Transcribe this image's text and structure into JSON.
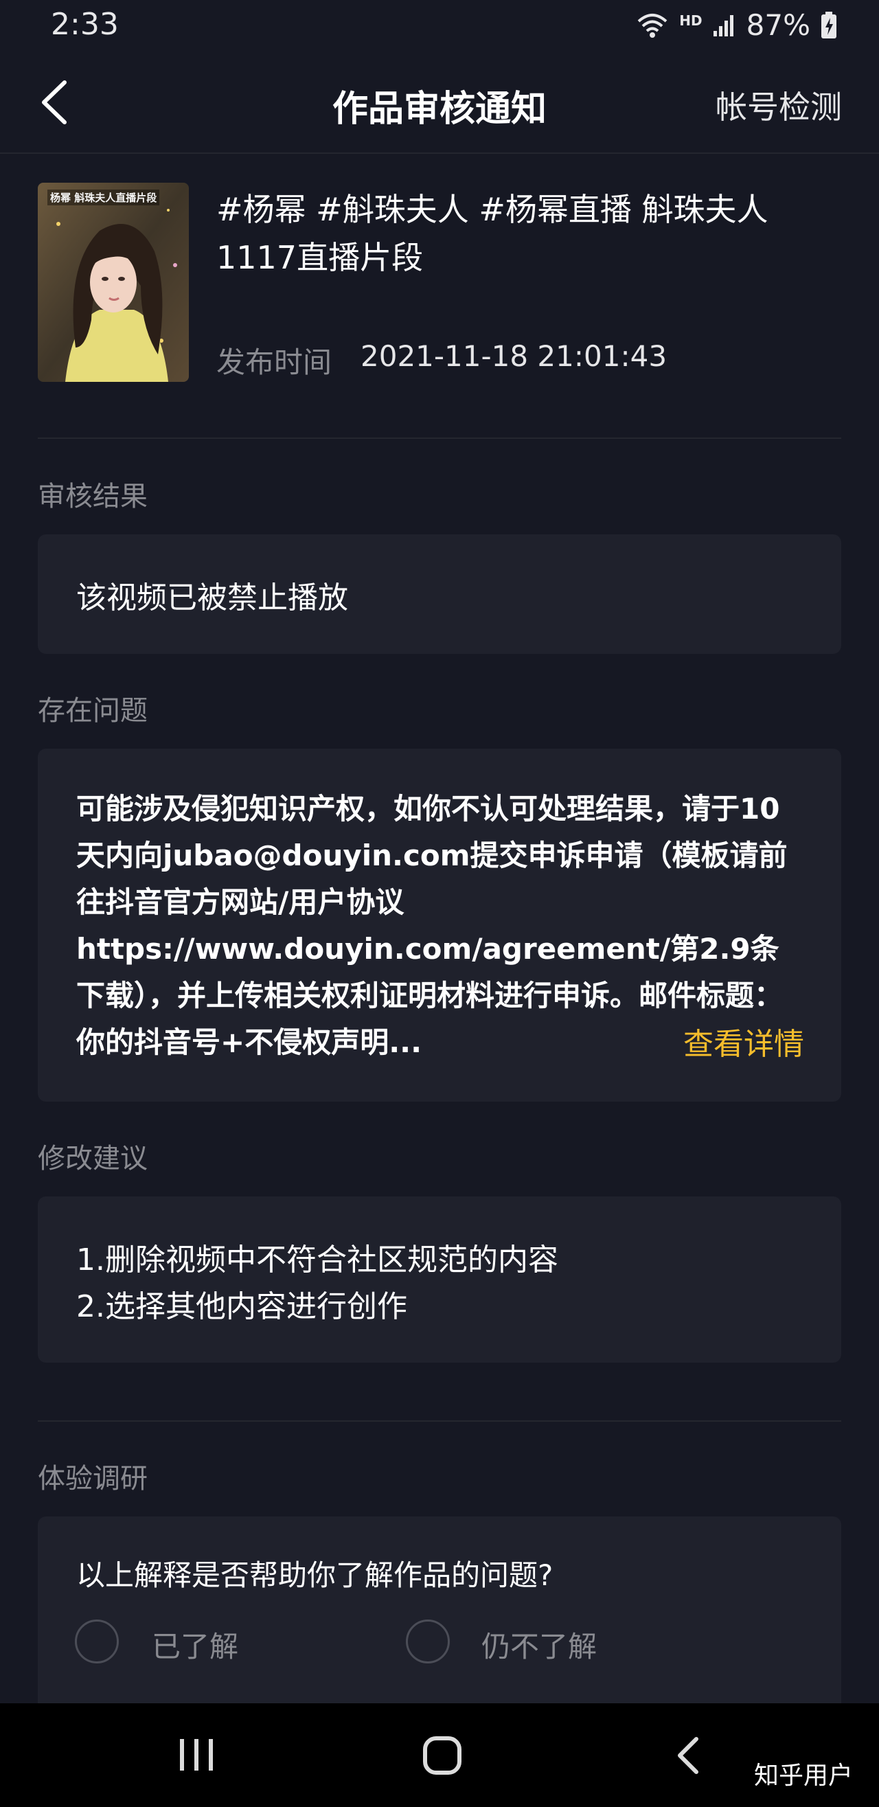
{
  "status_bar": {
    "time": "2:33",
    "network_badge": "HD",
    "battery": "87%"
  },
  "nav": {
    "title": "作品审核通知",
    "action": "帐号检测"
  },
  "video": {
    "thumbnail_caption": "杨幂 斛珠夫人直播片段",
    "title": "#杨幂 #斛珠夫人 #杨幂直播 斛珠夫人1117直播片段",
    "publish_label": "发布时间",
    "publish_time": "2021-11-18 21:01:43"
  },
  "review_result": {
    "label": "审核结果",
    "text": "该视频已被禁止播放"
  },
  "issue": {
    "label": "存在问题",
    "text": "可能涉及侵犯知识产权，如你不认可处理结果，请于10天内向jubao@douyin.com提交申诉申请（模板请前往抖音官方网站/用户协议https://www.douyin.com/agreement/第2.9条下载），并上传相关权利证明材料进行申诉。邮件标题：你的抖音号+不侵权声明...",
    "detail_link": "查看详情"
  },
  "suggestion": {
    "label": "修改建议",
    "items": [
      "1.删除视频中不符合社区规范的内容",
      "2.选择其他内容进行创作"
    ]
  },
  "survey": {
    "label": "体验调研",
    "question": "以上解释是否帮助你了解作品的问题?",
    "options": [
      "已了解",
      "仍不了解"
    ]
  },
  "watermark": "知乎用户",
  "colors": {
    "background": "#161823",
    "card": "#1f212c",
    "accent_link": "#f5bd2c",
    "muted_text": "#8a8b91"
  }
}
